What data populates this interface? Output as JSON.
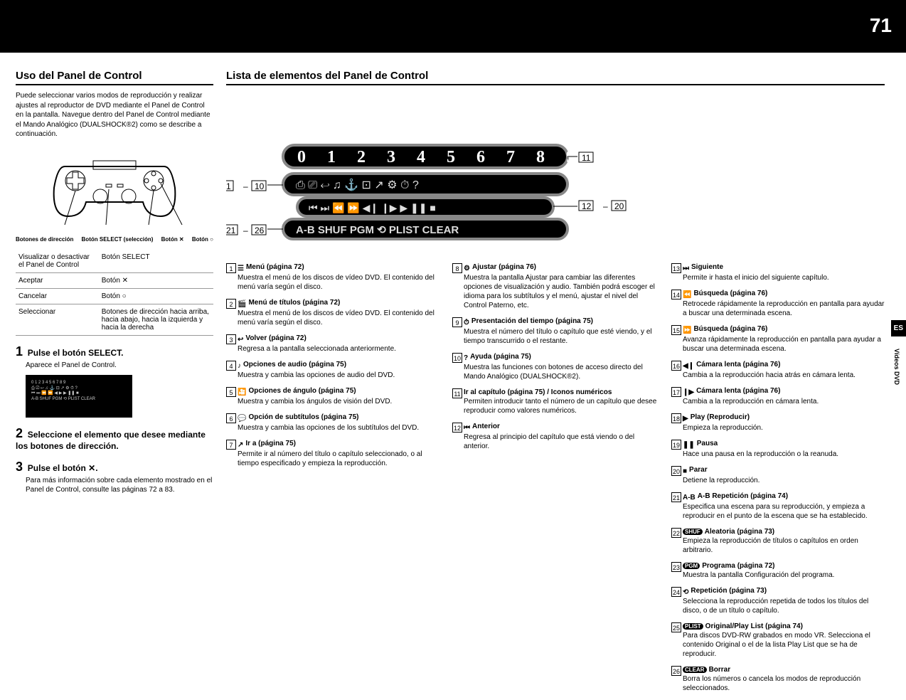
{
  "pageNumber": "71",
  "langBadge": "ES",
  "sideLabel": "Vídeos DVD",
  "left": {
    "heading": "Uso del Panel de Control",
    "intro": "Puede seleccionar varios modos de reproducción y realizar ajustes al reproductor de DVD mediante el Panel de Control en la pantalla. Navegue dentro del Panel de Control mediante el Mando Analógico (DUALSHOCK®2) como se describe a continuación.",
    "labels": {
      "l1": "Botones de dirección",
      "l2": "Botón SELECT (selección)",
      "l3": "Botón ✕",
      "l4": "Botón ○"
    },
    "table": [
      {
        "a": "Visualizar o desactivar el Panel de Control",
        "b": "Botón SELECT"
      },
      {
        "a": "Aceptar",
        "b": "Botón ✕"
      },
      {
        "a": "Cancelar",
        "b": "Botón ○"
      },
      {
        "a": "Seleccionar",
        "b": "Botones de dirección hacia arriba, hacia abajo, hacia la izquierda y hacia la derecha"
      }
    ],
    "steps": [
      {
        "n": "1",
        "title": "Pulse el botón SELECT.",
        "desc": "Aparece el Panel de Control."
      },
      {
        "n": "2",
        "title": "Seleccione el elemento que desee mediante los botones de dirección.",
        "desc": ""
      },
      {
        "n": "3",
        "title": "Pulse el botón ✕.",
        "desc": "Para más información sobre cada elemento mostrado en el Panel de Control, consulte las páginas 72 a 83."
      }
    ],
    "miniLines": [
      "0 1 2 3 4 5 6 7 8 9",
      "⎙ ⎚ ↩ ♫ ⚓ ⊡ ↗ ⚙ ⏱ ?",
      "⏮ ⏭ ⏪ ⏩ ◀ ▶ ▶ ❚❚ ■",
      "A-B SHUF PGM ⟲ PLIST CLEAR"
    ]
  },
  "mid": {
    "heading": "Lista de elementos del Panel de Control",
    "row1": "1 - 10",
    "row2": "12 - 20",
    "row3": "21 - 26",
    "row4": "11"
  },
  "itemsA": [
    {
      "n": "1",
      "icon": "menu",
      "title": "Menú (página 72)",
      "desc": "Muestra el menú de los discos de vídeo DVD. El contenido del menú varía según el disco."
    },
    {
      "n": "2",
      "icon": "clap",
      "title": "Menú de títulos (página 72)",
      "desc": "Muestra el menú de los discos de vídeo DVD. El contenido del menú varía según el disco."
    },
    {
      "n": "3",
      "icon": "return",
      "title": "Volver (página 72)",
      "desc": "Regresa a la pantalla seleccionada anteriormente."
    },
    {
      "n": "4",
      "icon": "note",
      "title": "Opciones de audio (página 75)",
      "desc": "Muestra y cambia las opciones de audio del DVD."
    },
    {
      "n": "5",
      "icon": "angle",
      "title": "Opciones de ángulo (página 75)",
      "desc": "Muestra y cambia los ángulos de visión del DVD."
    },
    {
      "n": "6",
      "icon": "subtitle",
      "title": "Opción de subtítulos (página 75)",
      "desc": "Muestra y cambia las opciones de los subtítulos del DVD."
    },
    {
      "n": "7",
      "icon": "goto",
      "title": "Ir a (página 75)",
      "desc": "Permite ir al número del título o capítulo seleccionado, o al tiempo especificado y empieza la reproducción."
    }
  ],
  "itemsB": [
    {
      "n": "8",
      "icon": "gear",
      "title": "Ajustar (página 76)",
      "desc": "Muestra la pantalla Ajustar para cambiar las diferentes opciones de visualización y audio. También podrá escoger el idioma para los subtítulos y el menú, ajustar el nivel del Control Paterno, etc."
    },
    {
      "n": "9",
      "icon": "time",
      "title": "Presentación del tiempo (página 75)",
      "desc": "Muestra el número del título o capítulo que esté viendo, y el tiempo transcurrido o el restante."
    },
    {
      "n": "10",
      "icon": "help",
      "title": "Ayuda (página 75)",
      "desc": "Muestra las funciones con botones de acceso directo del Mando Analógico (DUALSHOCK®2)."
    },
    {
      "n": "11",
      "icon": "",
      "title": "Ir al capítulo (página 75) / Iconos numéricos",
      "desc": "Permiten introducir tanto el número de un capítulo que desee reproducir como valores numéricos."
    },
    {
      "n": "12",
      "icon": "prev",
      "title": "Anterior",
      "desc": "Regresa al principio del capítulo que está viendo o del anterior."
    }
  ],
  "itemsC": [
    {
      "n": "13",
      "icon": "next",
      "title": "Siguiente",
      "desc": "Permite ir hasta el inicio del siguiente capítulo."
    },
    {
      "n": "14",
      "icon": "rew",
      "title": "Búsqueda (página 76)",
      "desc": "Retrocede rápidamente la reproducción en pantalla para ayudar a buscar una determinada escena."
    },
    {
      "n": "15",
      "icon": "ffwd",
      "title": "Búsqueda (página 76)",
      "desc": "Avanza rápidamente la reproducción en pantalla para ayudar a buscar una determinada escena."
    },
    {
      "n": "16",
      "icon": "slowrev",
      "title": "Cámara lenta (página 76)",
      "desc": "Cambia a la reproducción hacia atrás en cámara lenta."
    },
    {
      "n": "17",
      "icon": "slowfwd",
      "title": "Cámara lenta (página 76)",
      "desc": "Cambia a la reproducción en cámara lenta."
    },
    {
      "n": "18",
      "icon": "play",
      "title": "Play (Reproducir)",
      "desc": "Empieza la reproducción."
    },
    {
      "n": "19",
      "icon": "pause",
      "title": "Pausa",
      "desc": "Hace una pausa en la reproducción o la reanuda."
    },
    {
      "n": "20",
      "icon": "stop",
      "title": "Parar",
      "desc": "Detiene la reproducción."
    },
    {
      "n": "21",
      "icon": "ab",
      "title": "A-B Repetición (página 74)",
      "desc": "Especifica una escena para su reproducción, y empieza a reproducir en el punto de la escena que se ha establecido."
    },
    {
      "n": "22",
      "icon": "shuf",
      "title": "Aleatoria (página 73)",
      "desc": "Empieza la reproducción de títulos o capítulos en orden arbitrario."
    },
    {
      "n": "23",
      "icon": "pgm",
      "title": "Programa (página 72)",
      "desc": "Muestra la pantalla Configuración del programa."
    },
    {
      "n": "24",
      "icon": "repeat",
      "title": "Repetición (página 73)",
      "desc": "Selecciona la reproducción repetida de todos los títulos del disco, o de un título o capítulo."
    },
    {
      "n": "25",
      "icon": "plist",
      "title": "Original/Play List (página 74)",
      "desc": "Para discos DVD-RW grabados en modo VR. Selecciona el contenido Original o el de la lista Play List que se ha de reproducir."
    },
    {
      "n": "26",
      "icon": "clear",
      "title": "Borrar",
      "desc": "Borra los números o cancela los modos de reproducción seleccionados."
    }
  ]
}
